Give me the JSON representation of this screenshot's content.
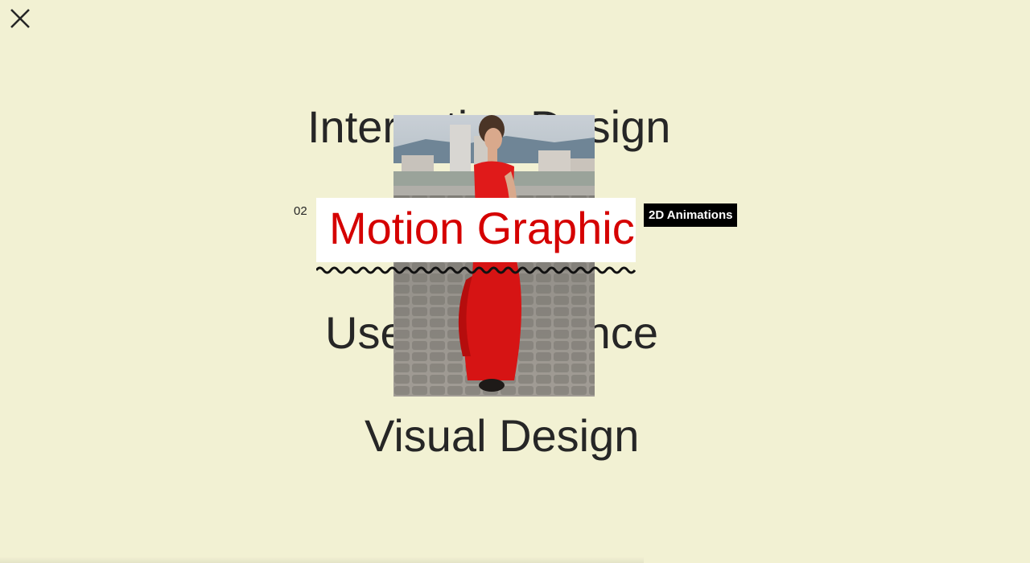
{
  "controls": {
    "close_icon": "close-icon"
  },
  "colors": {
    "background": "#f2f1d3",
    "text": "#262626",
    "accent": "#d50000",
    "badge_bg": "#000000",
    "badge_text": "#ffffff"
  },
  "menu": {
    "items": [
      {
        "label": "Interaction Design"
      },
      {
        "label": "Motion Graphic",
        "index": "02",
        "tag": "2D Animations",
        "active": true
      },
      {
        "label": "User Experience"
      },
      {
        "label": "Visual Design"
      }
    ]
  },
  "preview": {
    "image": "woman-in-red-dress-photo"
  }
}
